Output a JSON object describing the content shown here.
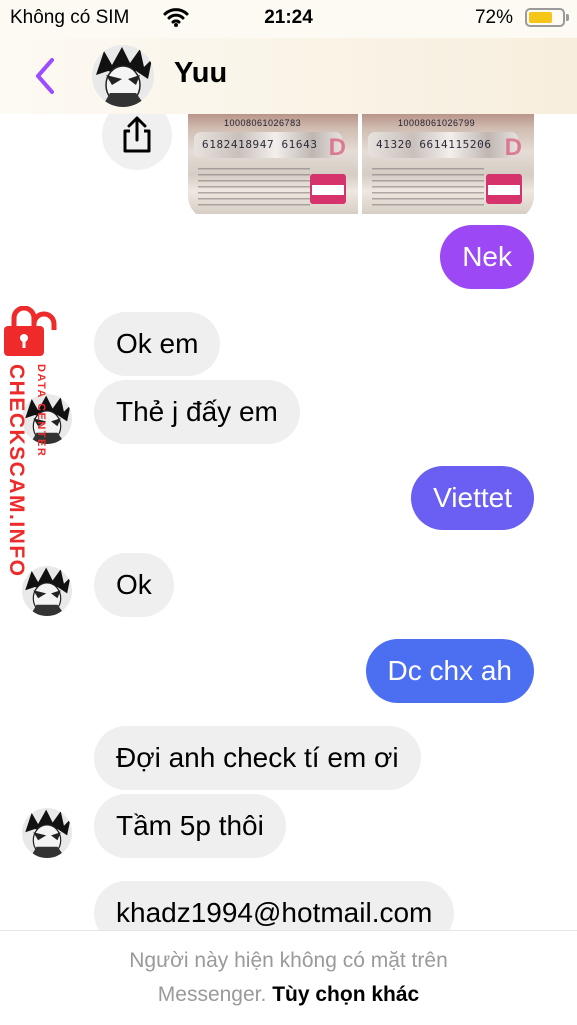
{
  "status_bar": {
    "carrier": "Không có SIM",
    "time": "21:24",
    "battery": "72%",
    "battery_level": 0.72
  },
  "header": {
    "contact_name": "Yuu",
    "back_icon": "chevron-left-icon",
    "accent_color": "#9b4dff"
  },
  "attachments": {
    "share_icon": "share-icon",
    "cards": [
      {
        "serial": "10008061026783",
        "code": "6182418947 61643"
      },
      {
        "serial": "10008061026799",
        "code": "41320 6614115206"
      }
    ]
  },
  "messages": [
    {
      "side": "out",
      "text": "Nek",
      "color": "#9c48f5"
    },
    {
      "side": "in",
      "text": "Ok em"
    },
    {
      "side": "in",
      "text": "Thẻ j đấy em"
    },
    {
      "side": "out",
      "text": "Viettet",
      "color": "#6a5ef3"
    },
    {
      "side": "in",
      "text": "Ok"
    },
    {
      "side": "out",
      "text": "Dc chx ah",
      "color": "#4c6ff1"
    },
    {
      "side": "in",
      "text": "Đợi anh check tí em ơi"
    },
    {
      "side": "in",
      "text": "Tầm 5p thôi"
    },
    {
      "side": "in",
      "text": "khadz1994@hotmail.com"
    }
  ],
  "watermark": {
    "brand": "CHECKSCAM.INFO",
    "sub": "DATA CENTER",
    "color": "#ee2a2a"
  },
  "footer": {
    "line1": "Người này hiện không có mặt trên",
    "line2_prefix": "Messenger.",
    "link": "Tùy chọn khác"
  }
}
